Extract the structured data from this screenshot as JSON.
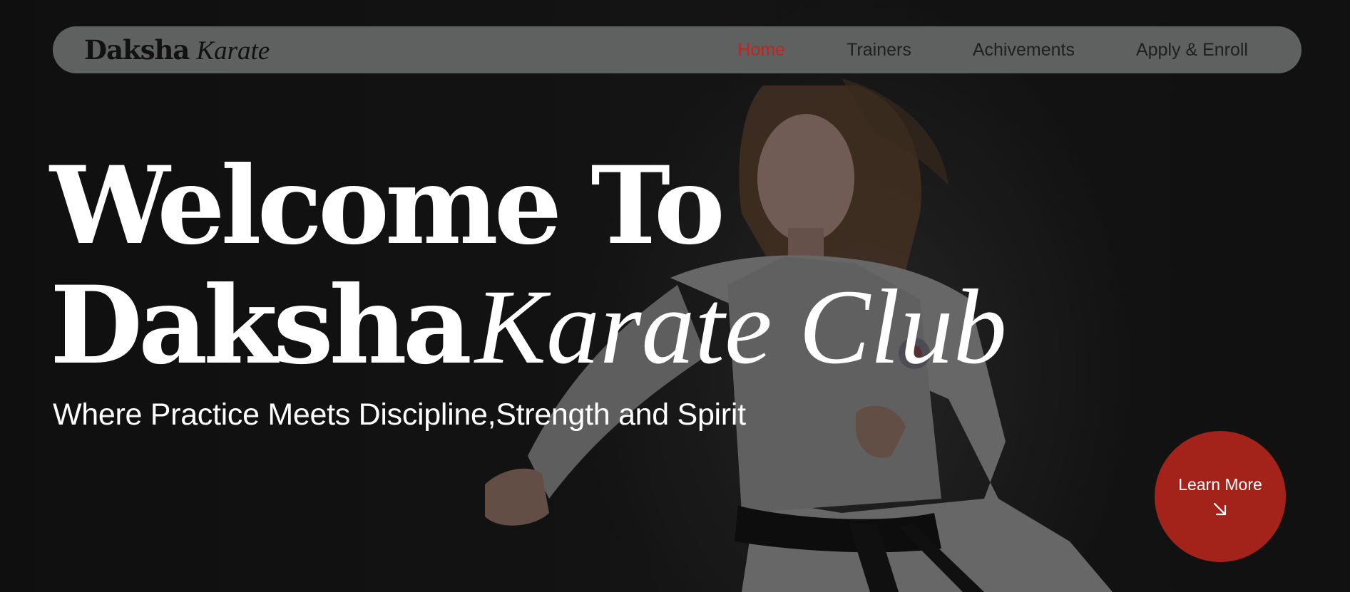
{
  "brand": {
    "name_bold": "Daksha",
    "name_italic": "Karate"
  },
  "nav": {
    "items": [
      {
        "label": "Home",
        "active": true
      },
      {
        "label": "Trainers",
        "active": false
      },
      {
        "label": "Achivements",
        "active": false
      },
      {
        "label": "Apply & Enroll",
        "active": false
      }
    ]
  },
  "hero": {
    "line1": "Welcome To",
    "line2_bold": "Daksha",
    "line2_italic": "Karate Club",
    "subtitle": "Where Practice Meets Discipline,Strength and Spirit"
  },
  "cta": {
    "label": "Learn More",
    "icon": "arrow-down-right-icon"
  },
  "colors": {
    "accent": "#c4241d",
    "cta_bg": "#a3231b",
    "nav_bg": "#5f6060",
    "page_bg": "#141414"
  }
}
